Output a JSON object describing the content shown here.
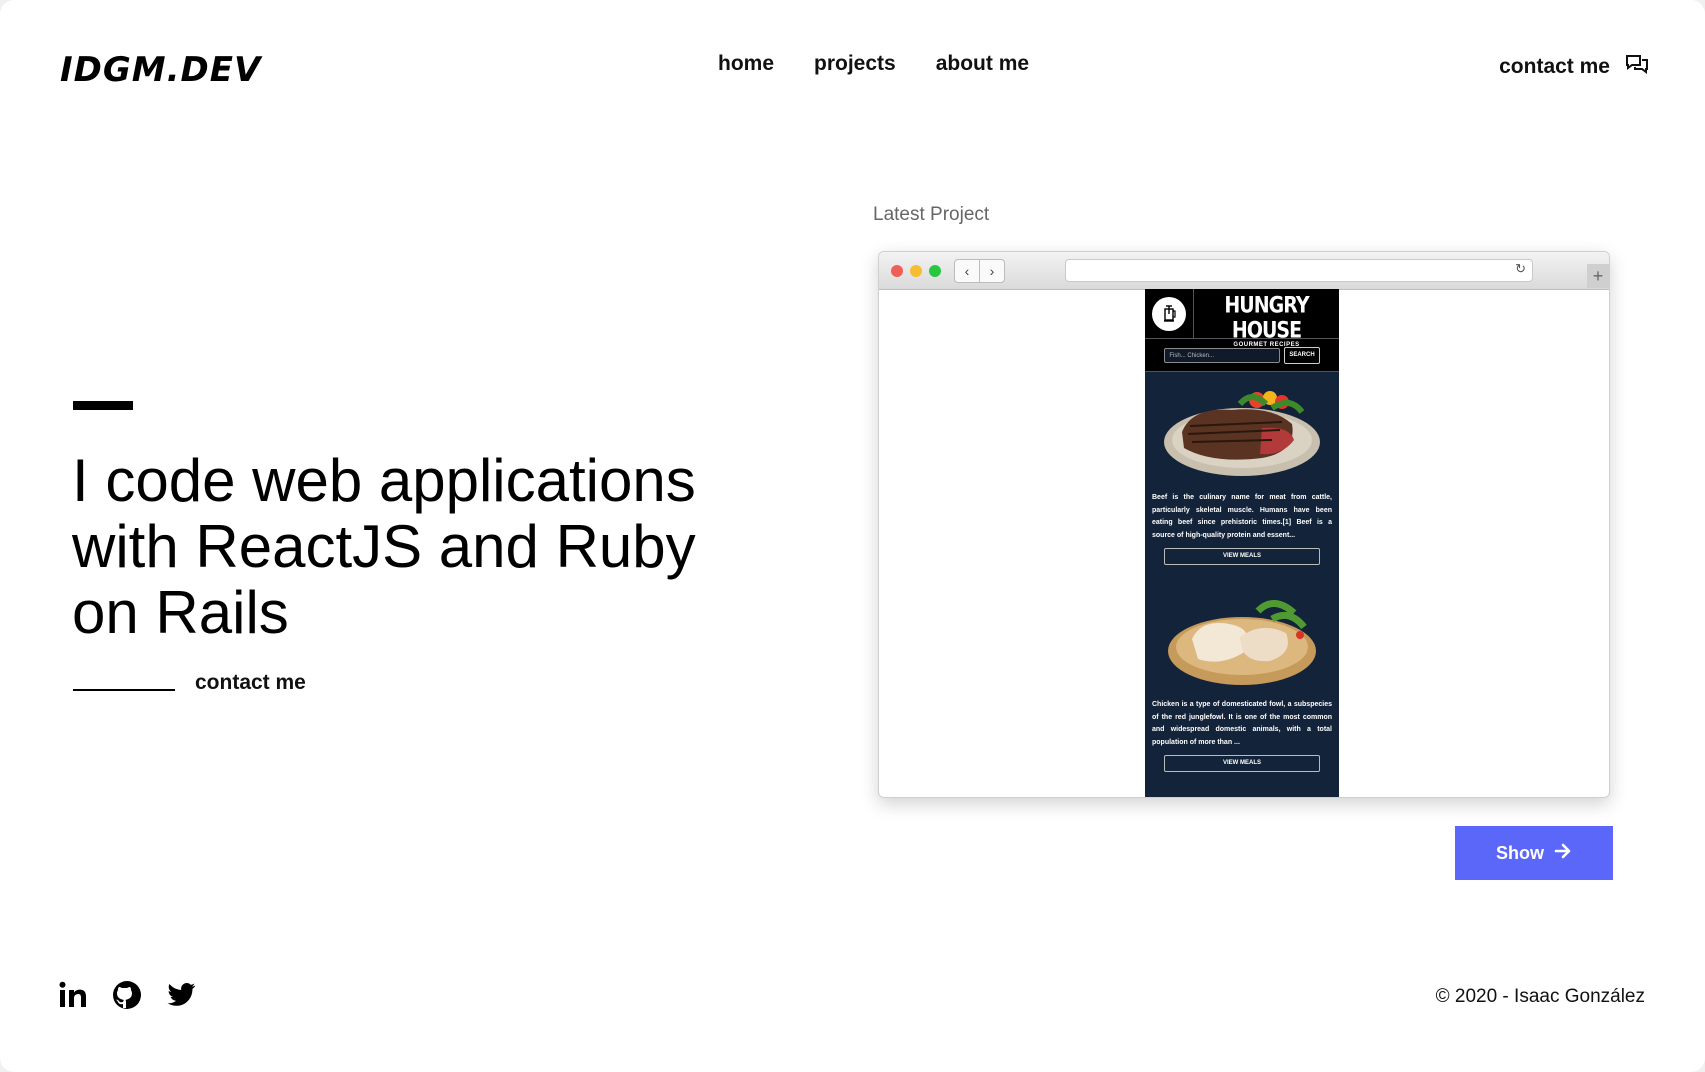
{
  "header": {
    "logo": "IDGM.DEV",
    "nav": [
      "home",
      "projects",
      "about me"
    ],
    "contact": "contact me",
    "contact_icon": "chat-bubbles-icon"
  },
  "hero": {
    "title_lines": [
      "I code web applications",
      "with ReactJS and Ruby",
      "on Rails"
    ],
    "cta": "contact me"
  },
  "latest": {
    "label": "Latest Project",
    "preview": {
      "site_title": "HUNGRY HOUSE",
      "site_subtitle": "GOURMET RECIPES",
      "search_placeholder": "Fish... Chicken...",
      "search_button": "SEARCH",
      "cards": [
        {
          "text": "Beef is the culinary name for meat from cattle, particularly skeletal muscle. Humans have been eating beef since prehistoric times.[1] Beef is a source of high-quality protein and essent...",
          "button": "VIEW MEALS"
        },
        {
          "text": "Chicken is a type of domesticated fowl, a subspecies of the red junglefowl. It is one of the most common and widespread domestic animals, with a total population of more than ...",
          "button": "VIEW MEALS"
        }
      ]
    },
    "show_button": "Show"
  },
  "footer": {
    "socials": [
      "linkedin-icon",
      "github-icon",
      "twitter-icon"
    ],
    "copyright": "© 2020 - Isaac González"
  },
  "colors": {
    "accent": "#5b67f8",
    "preview_bg": "#13233a"
  }
}
